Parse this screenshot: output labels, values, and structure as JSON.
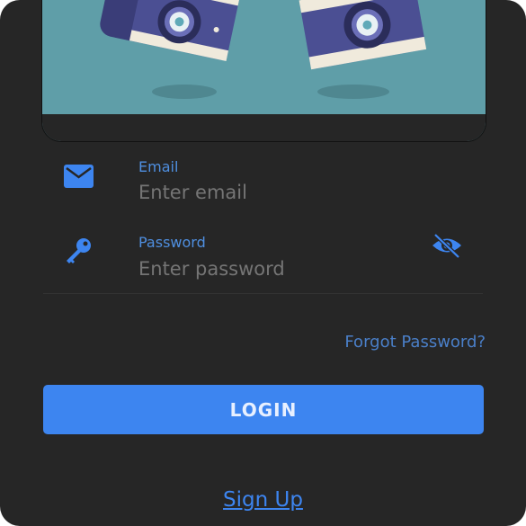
{
  "hero": {
    "image": "camera-illustration",
    "background_color": "#5f9ea8"
  },
  "email": {
    "label": "Email",
    "placeholder": "Enter email",
    "value": "",
    "icon": "mail-icon"
  },
  "password": {
    "label": "Password",
    "placeholder": "Enter password",
    "value": "",
    "icon": "key-icon",
    "visibility_icon": "eye-off-icon"
  },
  "forgot_password": "Forgot Password?",
  "login_button": "LOGIN",
  "signup_link": "Sign Up",
  "colors": {
    "accent": "#3d85f0",
    "background": "#262626"
  }
}
